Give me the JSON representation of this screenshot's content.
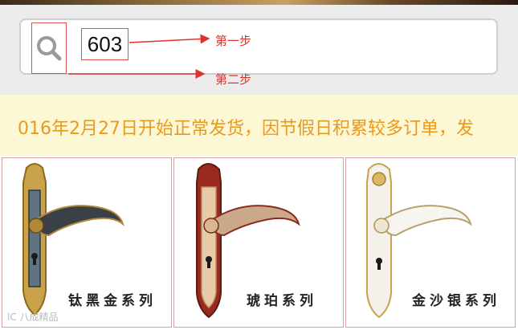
{
  "search": {
    "query": "603"
  },
  "annotations": {
    "step1": "第一步",
    "step2": "第二步"
  },
  "notice": {
    "text": "016年2月27日开始正常发货，因节假日积累较多订单，发"
  },
  "products": [
    {
      "label": "钛黑金系列"
    },
    {
      "label": "琥珀系列"
    },
    {
      "label": "金沙银系列"
    }
  ],
  "watermark": "lC 八成精品",
  "colors": {
    "annotation": "#e0322d",
    "notice_text": "#e89a1e",
    "notice_bg": "#fcf8d6"
  }
}
